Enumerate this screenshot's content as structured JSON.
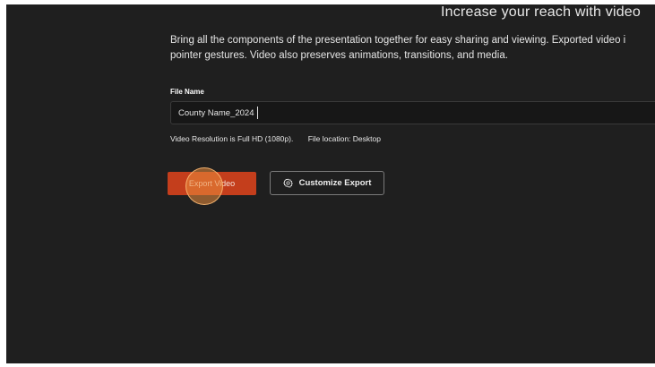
{
  "header": {
    "title": "Increase your reach with video"
  },
  "description": {
    "line1": "Bring all the components of the presentation together for easy sharing and viewing. Exported video i",
    "line2": "pointer gestures. Video also preserves animations, transitions, and media."
  },
  "file_name": {
    "label": "File Name",
    "value": "County Name_2024"
  },
  "info": {
    "resolution": "Video Resolution is Full HD (1080p).",
    "location": "File location: Desktop"
  },
  "buttons": {
    "export_label": "Export Video",
    "customize_label": "Customize Export",
    "customize_icon": "gear-icon"
  },
  "colors": {
    "background": "#1f1f1f",
    "accent": "#c43e1c",
    "click_indicator": "#eb8c3c"
  }
}
